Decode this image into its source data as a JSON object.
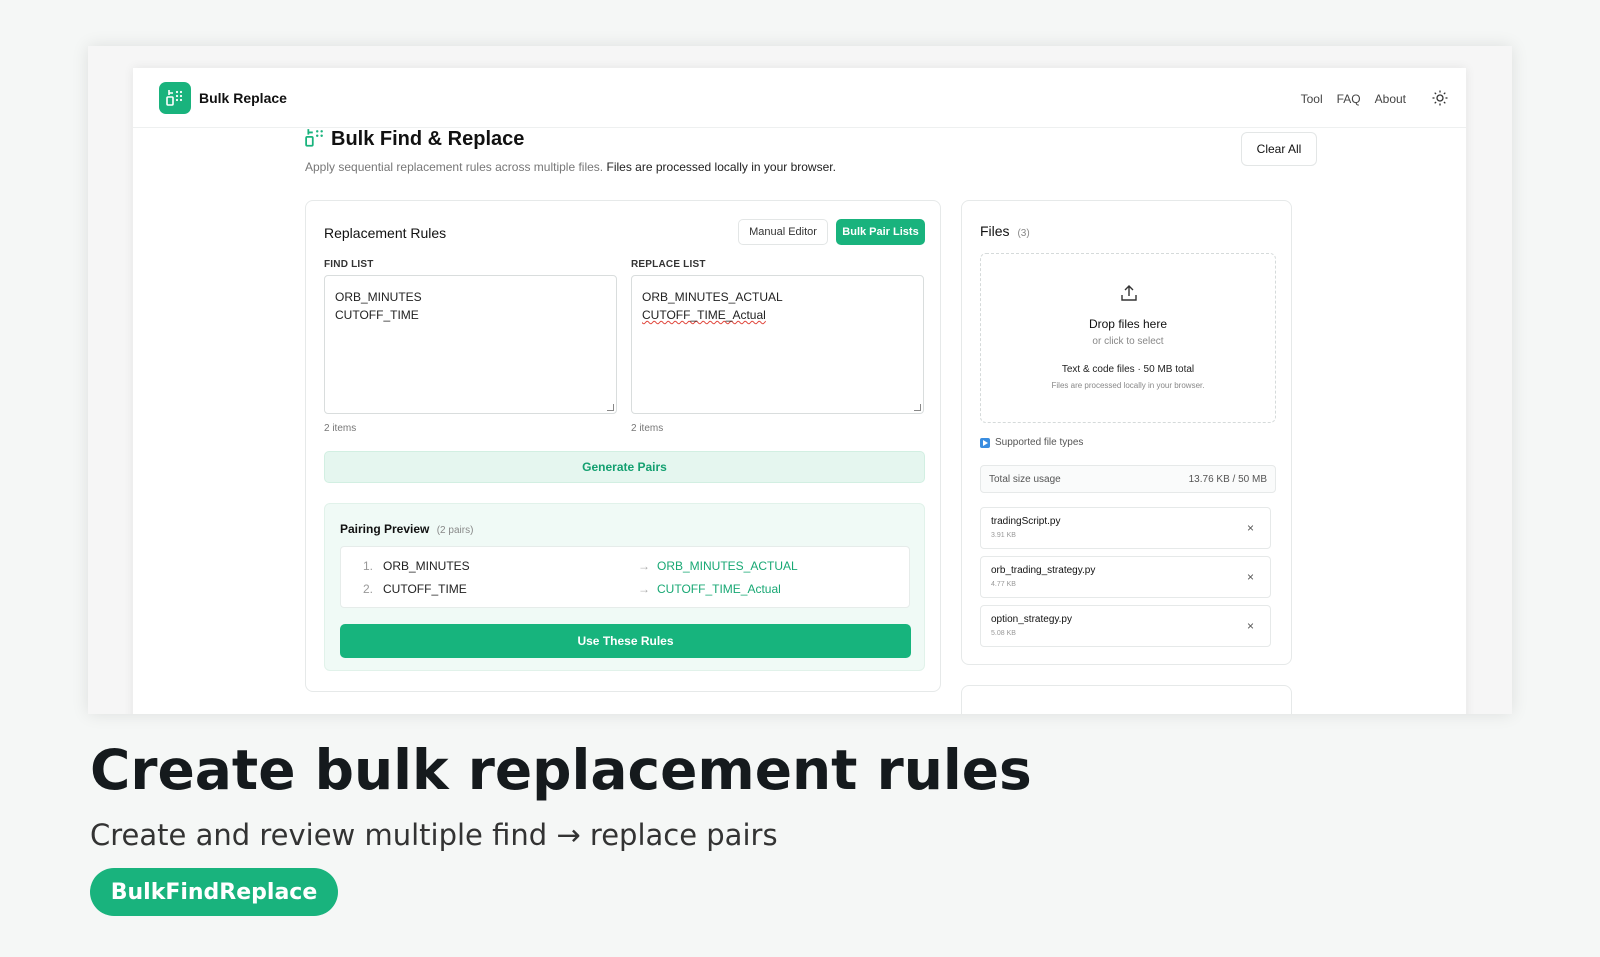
{
  "app": {
    "brand": "Bulk Replace",
    "nav": [
      "Tool",
      "FAQ",
      "About"
    ],
    "theme_icon": "sun-icon"
  },
  "page": {
    "title": "Bulk Find & Replace",
    "subtitle_muted": "Apply sequential replacement rules across multiple files.",
    "subtitle_strong": "Files are processed locally in your browser.",
    "clear_label": "Clear All"
  },
  "rules": {
    "title": "Replacement Rules",
    "modes": {
      "manual": "Manual Editor",
      "bulk": "Bulk Pair Lists"
    },
    "find_label": "FIND LIST",
    "replace_label": "REPLACE LIST",
    "find_items": [
      "ORB_MINUTES",
      "CUTOFF_TIME"
    ],
    "replace_items": [
      "ORB_MINUTES_ACTUAL",
      "CUTOFF_TIME_Actual"
    ],
    "find_count": "2 items",
    "replace_count": "2 items",
    "generate_label": "Generate Pairs",
    "preview_title": "Pairing Preview",
    "preview_count": "(2 pairs)",
    "pairs": [
      {
        "num": "1.",
        "find": "ORB_MINUTES",
        "arrow": "→",
        "replace": "ORB_MINUTES_ACTUAL"
      },
      {
        "num": "2.",
        "find": "CUTOFF_TIME",
        "arrow": "→",
        "replace": "CUTOFF_TIME_Actual"
      }
    ],
    "use_label": "Use These Rules"
  },
  "files": {
    "title": "Files",
    "count": "(3)",
    "drop_main": "Drop files here",
    "drop_sub": "or click to select",
    "drop_types": "Text & code files · 50 MB total",
    "drop_local": "Files are processed locally in your browser.",
    "supported_label": "Supported file types",
    "usage_label": "Total size usage",
    "usage_value": "13.76 KB / 50 MB",
    "items": [
      {
        "name": "tradingScript.py",
        "size": "3.91 KB"
      },
      {
        "name": "orb_trading_strategy.py",
        "size": "4.77 KB"
      },
      {
        "name": "option_strategy.py",
        "size": "5.08 KB"
      }
    ],
    "remove_glyph": "×"
  },
  "caption": {
    "title": "Create bulk replacement rules",
    "subtitle": "Create and review multiple find → replace pairs",
    "tag": "BulkFindReplace"
  },
  "colors": {
    "accent": "#19b37d",
    "accent_light": "#e5f6ef",
    "link_green": "#18a874"
  }
}
